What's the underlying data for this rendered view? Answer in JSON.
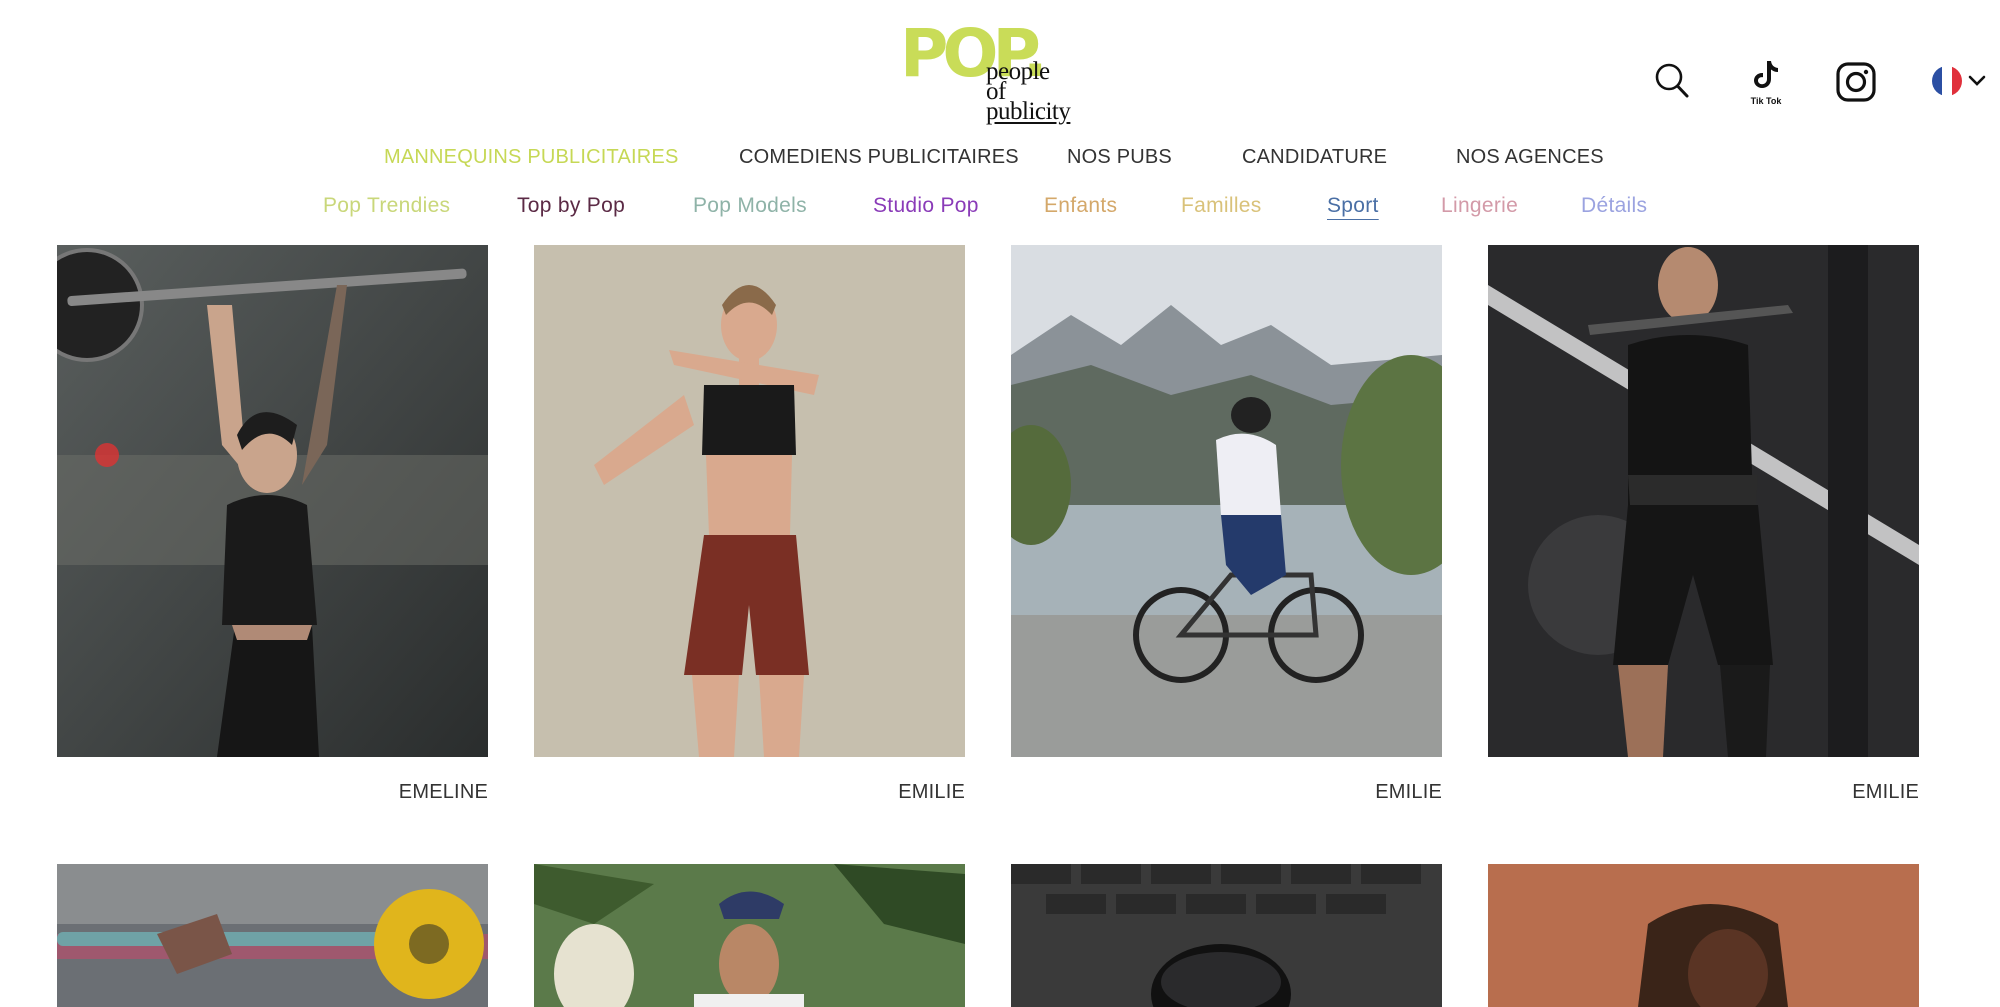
{
  "brand": {
    "logo_main": "POP.",
    "logo_lines": [
      "people",
      "of",
      "publicity"
    ]
  },
  "header_icons": {
    "search": "search-icon",
    "tiktok": "tiktok-icon",
    "tiktok_label": "Tik Tok",
    "instagram": "instagram-icon",
    "language": "french-flag-icon"
  },
  "main_nav": [
    {
      "label": "MANNEQUINS PUBLICITAIRES",
      "active": true
    },
    {
      "label": "COMEDIENS PUBLICITAIRES",
      "active": false
    },
    {
      "label": "NOS PUBS",
      "active": false
    },
    {
      "label": "CANDIDATURE",
      "active": false
    },
    {
      "label": "NOS AGENCES",
      "active": false
    }
  ],
  "sub_nav": [
    {
      "label": "Pop Trendies",
      "color": "#c9d77a"
    },
    {
      "label": "Top by Pop",
      "color": "#5b2a45"
    },
    {
      "label": "Pop Models",
      "color": "#8fb3a8"
    },
    {
      "label": "Studio Pop",
      "color": "#8a3bb8"
    },
    {
      "label": "Enfants",
      "color": "#d4a86a"
    },
    {
      "label": "Familles",
      "color": "#d9c27a"
    },
    {
      "label": "Sport",
      "color": "#4a6fa5",
      "current": true
    },
    {
      "label": "Lingerie",
      "color": "#d39aa8"
    },
    {
      "label": "Détails",
      "color": "#9ba3e0"
    }
  ],
  "models_row1": [
    {
      "name": "EMELINE"
    },
    {
      "name": "EMILIE"
    },
    {
      "name": "EMILIE"
    },
    {
      "name": "EMILIE"
    }
  ],
  "colors": {
    "brand_green": "#c9dc58",
    "text": "#333333"
  }
}
